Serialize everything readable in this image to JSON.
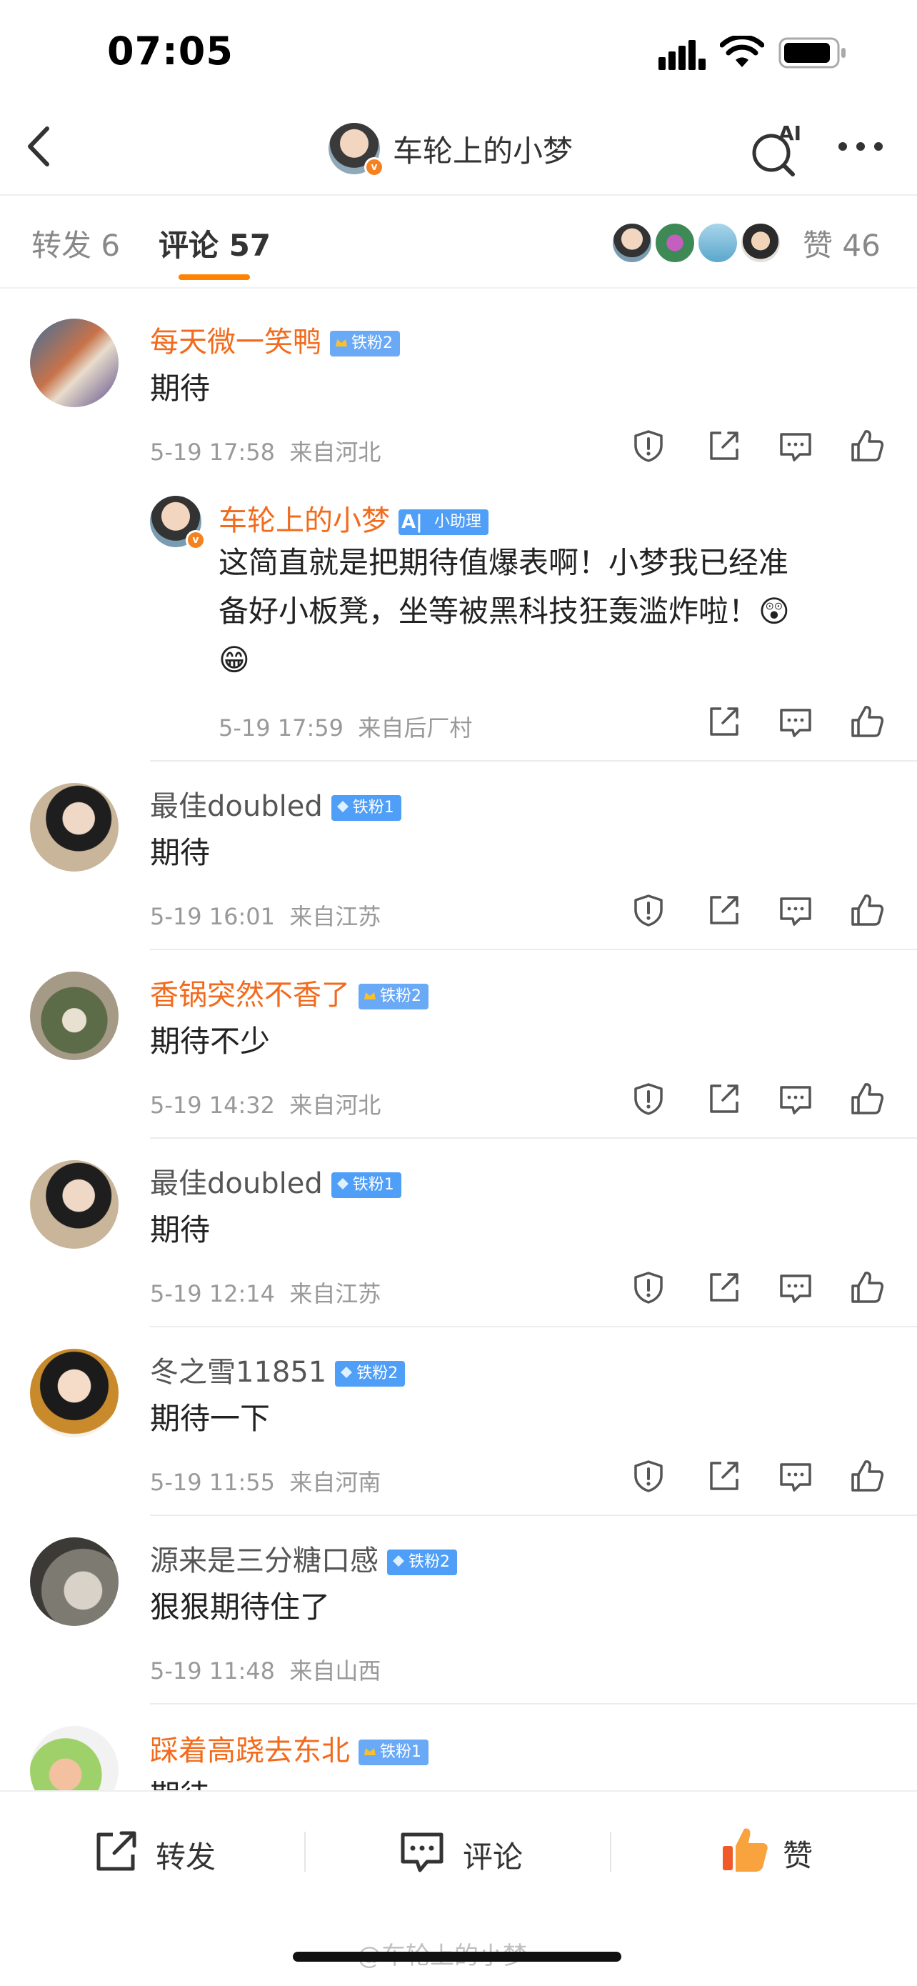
{
  "status": {
    "time": "07:05"
  },
  "header": {
    "title": "车轮上的小梦",
    "more_icon": "more-horizontal-icon",
    "ai_icon": "ai-search-icon",
    "ai_label": "AI"
  },
  "tabs": {
    "repost": "转发 6",
    "comment": "评论 57",
    "likes": "赞 46"
  },
  "comments": [
    {
      "name": "每天微一笑鸭",
      "name_color": "#f26b1d",
      "fan": "铁粉2",
      "text": "期待",
      "time": "5-19 17:58",
      "loc": "来自河北",
      "reply": {
        "name": "车轮上的小梦",
        "badge": "小助理",
        "text1": "这简直就是把期待值爆表啊！小梦我已经准",
        "text2": "备好小板凳，坐等被黑科技狂轰滥炸啦！😲",
        "text3": "😁",
        "time": "5-19 17:59",
        "loc": "来自后厂村"
      }
    },
    {
      "name": "最佳doubled",
      "fan": "铁粉1",
      "text": "期待",
      "time": "5-19 16:01",
      "loc": "来自江苏"
    },
    {
      "name": "香锅突然不香了",
      "fan": "铁粉2",
      "text": "期待不少",
      "time": "5-19 14:32",
      "loc": "来自河北"
    },
    {
      "name": "最佳doubled",
      "fan": "铁粉1",
      "text": "期待",
      "time": "5-19 12:14",
      "loc": "来自江苏"
    },
    {
      "name": "冬之雪11851",
      "fan": "铁粉2",
      "text": "期待一下",
      "time": "5-19 11:55",
      "loc": "来自河南"
    },
    {
      "name": "源来是三分糖口感",
      "fan": "铁粉2",
      "text": "狠狠期待住了",
      "time": "5-19 11:48",
      "loc": "来自山西"
    },
    {
      "name": "踩着高跷去东北",
      "fan": "铁粉1",
      "text": "期待"
    }
  ],
  "bottom": {
    "repost": "转发",
    "comment": "评论",
    "like": "赞"
  },
  "watermark": "@车轮上的小梦",
  "colors": {
    "accent": "#ff8200",
    "name_orange": "#f26b1d",
    "fan_blue": "#4f9ef7",
    "like_red": "#f05a28"
  }
}
